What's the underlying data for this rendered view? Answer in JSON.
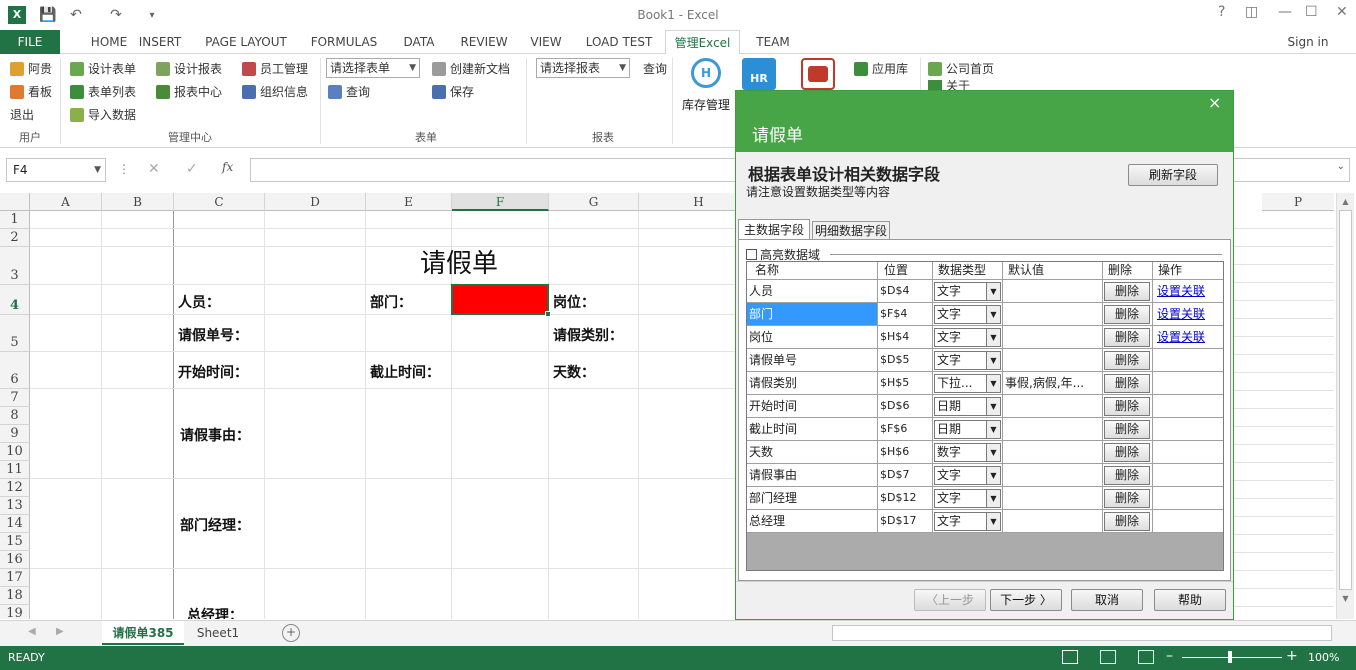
{
  "window": {
    "title": "Book1 - Excel"
  },
  "tabs": [
    "FILE",
    "HOME",
    "INSERT",
    "PAGE LAYOUT",
    "FORMULAS",
    "DATA",
    "REVIEW",
    "VIEW",
    "LOAD TEST",
    "管理Excel",
    "TEAM"
  ],
  "signin": "Sign in",
  "ribbon": {
    "user": {
      "name": "阿贵",
      "board": "看板",
      "logout": "退出",
      "group": "用户"
    },
    "mgmt": {
      "design_form": "设计表单",
      "form_list": "表单列表",
      "import": "导入数据",
      "design_report": "设计报表",
      "report_center": "报表中心",
      "staff": "员工管理",
      "org": "组织信息",
      "group": "管理中心"
    },
    "forms": {
      "select_form": "请选择表单",
      "query": "查询",
      "new_doc": "创建新文档",
      "save": "保存",
      "group": "表单"
    },
    "reports": {
      "select_report": "请选择报表",
      "query": "查询",
      "group": "报表"
    },
    "apps": {
      "inventory": "库存管理",
      "hr": "HR",
      "app_store": "应用库",
      "home": "公司首页",
      "about": "关于"
    }
  },
  "formula_bar": {
    "cell_ref": "F4",
    "fx": "fx",
    "value": ""
  },
  "grid": {
    "columns": [
      "A",
      "B",
      "C",
      "D",
      "E",
      "F",
      "G",
      "H"
    ],
    "far_column": "P",
    "rows": [
      "1",
      "2",
      "3",
      "4",
      "5",
      "6",
      "7",
      "8",
      "9",
      "10",
      "11",
      "12",
      "13",
      "14",
      "15",
      "16",
      "17",
      "18",
      "19"
    ],
    "selected_col": "F",
    "selected_row": "4",
    "form_title": "请假单",
    "labels": {
      "person": "人员：",
      "dept": "部门：",
      "position": "岗位：",
      "leave_no": "请假单号：",
      "leave_type": "请假类别：",
      "start": "开始时间：",
      "end": "截止时间：",
      "days": "天数：",
      "reason": "请假事由：",
      "dept_mgr": "部门经理：",
      "gm": "总经理："
    },
    "highlight_color": "#ff0000"
  },
  "sheets": {
    "active": "请假单385",
    "other": "Sheet1"
  },
  "status": {
    "ready": "READY",
    "zoom": "100%"
  },
  "dialog": {
    "title": "请假单",
    "heading": "根据表单设计相关数据字段",
    "subheading": "请注意设置数据类型等内容",
    "refresh": "刷新字段",
    "tab_main": "主数据字段",
    "tab_detail": "明细数据字段",
    "highlight": "高亮数据域",
    "headers": {
      "name": "名称",
      "pos": "位置",
      "type": "数据类型",
      "default": "默认值",
      "delete": "删除",
      "op": "操作"
    },
    "rows": [
      {
        "name": "人员",
        "pos": "$D$4",
        "type": "文字",
        "default": "",
        "del": "删除",
        "op": "设置关联"
      },
      {
        "name": "部门",
        "pos": "$F$4",
        "type": "文字",
        "default": "",
        "del": "删除",
        "op": "设置关联"
      },
      {
        "name": "岗位",
        "pos": "$H$4",
        "type": "文字",
        "default": "",
        "del": "删除",
        "op": "设置关联"
      },
      {
        "name": "请假单号",
        "pos": "$D$5",
        "type": "文字",
        "default": "",
        "del": "删除",
        "op": ""
      },
      {
        "name": "请假类别",
        "pos": "$H$5",
        "type": "下拉...",
        "default": "事假,病假,年...",
        "del": "删除",
        "op": ""
      },
      {
        "name": "开始时间",
        "pos": "$D$6",
        "type": "日期",
        "default": "",
        "del": "删除",
        "op": ""
      },
      {
        "name": "截止时间",
        "pos": "$F$6",
        "type": "日期",
        "default": "",
        "del": "删除",
        "op": ""
      },
      {
        "name": "天数",
        "pos": "$H$6",
        "type": "数字",
        "default": "",
        "del": "删除",
        "op": ""
      },
      {
        "name": "请假事由",
        "pos": "$D$7",
        "type": "文字",
        "default": "",
        "del": "删除",
        "op": ""
      },
      {
        "name": "部门经理",
        "pos": "$D$12",
        "type": "文字",
        "default": "",
        "del": "删除",
        "op": ""
      },
      {
        "name": "总经理",
        "pos": "$D$17",
        "type": "文字",
        "default": "",
        "del": "删除",
        "op": ""
      }
    ],
    "prev": "〈上一步",
    "next": "下一步 〉",
    "cancel": "取消",
    "help": "帮助",
    "close": "×"
  }
}
